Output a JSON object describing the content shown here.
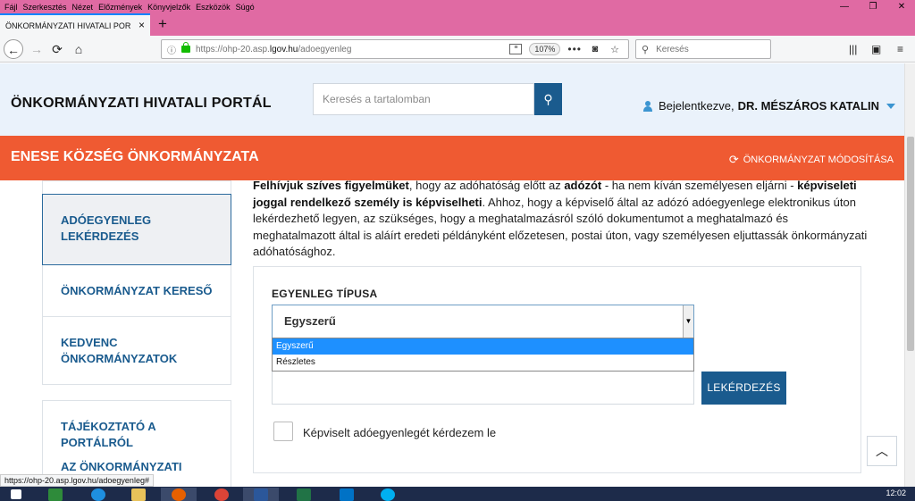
{
  "browser": {
    "menu": [
      "Fájl",
      "Szerkesztés",
      "Nézet",
      "Előzmények",
      "Könyvjelzők",
      "Eszközök",
      "Súgó"
    ],
    "tab_title": "ÖNKORMÁNYZATI HIVATALI PORT",
    "tab_close": "×",
    "new_tab": "+",
    "url_prefix": "https://ohp-20.asp.",
    "url_domain": "lgov.hu",
    "url_path": "/adoegyenleg",
    "zoom": "107%",
    "search_placeholder": "Keresés",
    "status_url": "https://ohp-20.asp.lgov.hu/adoegyenleg#"
  },
  "header": {
    "portal_title": "ÖNKORMÁNYZATI HIVATALI PORTÁL",
    "search_placeholder": "Keresés a tartalomban",
    "login_prefix": "Bejelentkezve,",
    "login_name": "DR. MÉSZÁROS KATALIN"
  },
  "municipality": {
    "name": "ENESE KÖZSÉG ÖNKORMÁNYZATA",
    "change_label": "ÖNKORMÁNYZAT MÓDOSÍTÁSA"
  },
  "sidebar": {
    "items": [
      {
        "label": "ADÓEGYENLEG LEKÉRDEZÉS"
      },
      {
        "label": "ÖNKORMÁNYZAT KERESŐ"
      },
      {
        "label": "KEDVENC ÖNKORMÁNYZATOK"
      },
      {
        "label": "TÁJÉKOZTATÓ A PORTÁLRÓL"
      },
      {
        "label": "AZ ÖNKORMÁNYZATI"
      }
    ]
  },
  "intro": {
    "b1": "Felhívjuk szíves figyelmüket",
    "t1": ", hogy az adóhatóság előtt az ",
    "b2": "adózót",
    "t2": " - ha nem kíván személyesen eljárni - ",
    "b3": "képviseleti joggal rendelkező személy is képviselheti",
    "t3": ". Ahhoz, hogy a képviselő által az adózó adóegyenlege elektronikus úton lekérdezhető legyen, az szükséges, hogy a meghatalmazásról szóló  dokumentumot a meghatalmazó és meghatalmazott által is aláírt eredeti példányként előzetesen, postai úton, vagy személyesen eljuttassák önkormányzati adóhatósághoz."
  },
  "form": {
    "balance_type_label": "EGYENLEG TÍPUSA",
    "selected": "Egyszerű",
    "options": [
      "Egyszerű",
      "Részletes"
    ],
    "query_button": "LEKÉRDEZÉS",
    "represented_checkbox_label": "Képviselt adóegyenlegét kérdezem le"
  },
  "taskbar": {
    "clock": "12:02"
  }
}
